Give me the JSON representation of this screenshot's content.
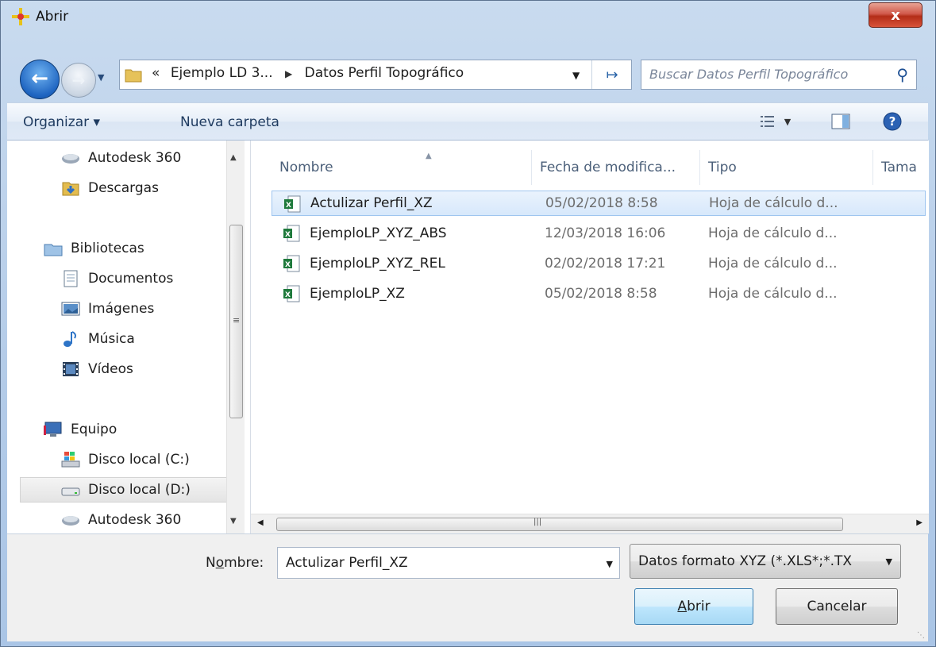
{
  "window": {
    "title": "Abrir",
    "close_label": "x"
  },
  "address": {
    "crumbs": [
      "Ejemplo LD 3...",
      "Datos Perfil Topográfico"
    ],
    "prefix": "«"
  },
  "search": {
    "placeholder": "Buscar Datos Perfil Topográfico"
  },
  "toolbar": {
    "organize": "Organizar ▾",
    "new_folder": "Nueva carpeta"
  },
  "nav": {
    "items": [
      {
        "label": "Autodesk 360",
        "icon": "cloud-icon"
      },
      {
        "label": "Descargas",
        "icon": "downloads-folder-icon"
      },
      {
        "label": "Bibliotecas",
        "icon": "libraries-icon"
      },
      {
        "label": "Documentos",
        "icon": "documents-icon"
      },
      {
        "label": "Imágenes",
        "icon": "pictures-icon"
      },
      {
        "label": "Música",
        "icon": "music-icon"
      },
      {
        "label": "Vídeos",
        "icon": "videos-icon"
      },
      {
        "label": "Equipo",
        "icon": "computer-icon"
      },
      {
        "label": "Disco local (C:)",
        "icon": "system-drive-icon"
      },
      {
        "label": "Disco local (D:)",
        "icon": "drive-icon",
        "selected": true
      },
      {
        "label": "Autodesk 360",
        "icon": "cloud-icon"
      }
    ]
  },
  "list": {
    "columns": [
      "Nombre",
      "Fecha de modifica...",
      "Tipo",
      "Tama"
    ],
    "rows": [
      {
        "name": "Actulizar Perfil_XZ",
        "date": "05/02/2018 8:58",
        "type": "Hoja de cálculo d...",
        "selected": true
      },
      {
        "name": "EjemploLP_XYZ_ABS",
        "date": "12/03/2018 16:06",
        "type": "Hoja de cálculo d..."
      },
      {
        "name": "EjemploLP_XYZ_REL",
        "date": "02/02/2018 17:21",
        "type": "Hoja de cálculo d..."
      },
      {
        "name": "EjemploLP_XZ",
        "date": "05/02/2018 8:58",
        "type": "Hoja de cálculo d..."
      }
    ]
  },
  "footer": {
    "name_label_pre": "N",
    "name_label_u": "o",
    "name_label_post": "mbre:",
    "name_value": "Actulizar Perfil_XZ",
    "filter": "Datos formato XYZ (*.XLS*;*.TX",
    "open_u": "A",
    "open_rest": "brir",
    "cancel": "Cancelar"
  }
}
